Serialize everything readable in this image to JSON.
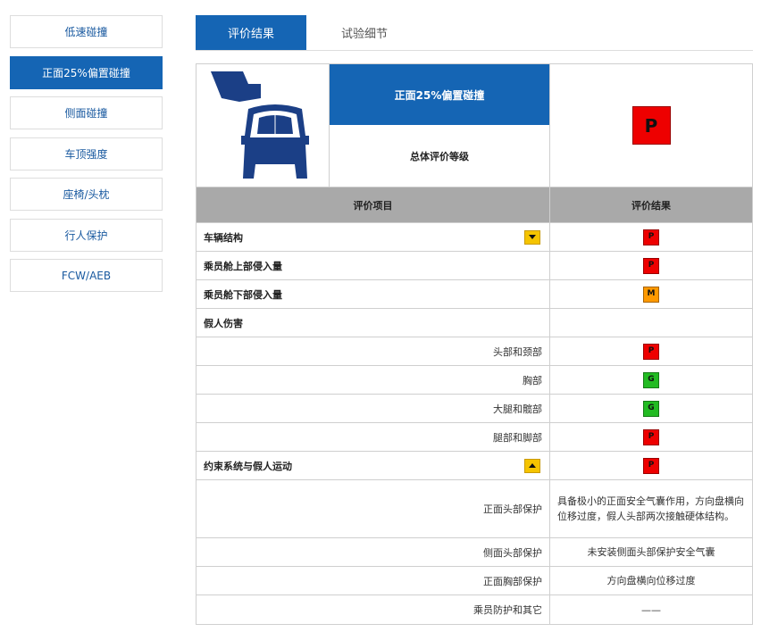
{
  "colors": {
    "primary": "#1565b4",
    "poor": "#ee0000",
    "marginal": "#ff9900",
    "good": "#22bb22",
    "toggle": "#f5c400",
    "header_gray": "#a9a9a9"
  },
  "sidebar": {
    "items": [
      {
        "label": "低速碰撞",
        "active": false
      },
      {
        "label": "正面25%偏置碰撞",
        "active": true
      },
      {
        "label": "侧面碰撞",
        "active": false
      },
      {
        "label": "车顶强度",
        "active": false
      },
      {
        "label": "座椅/头枕",
        "active": false
      },
      {
        "label": "行人保护",
        "active": false
      },
      {
        "label": "FCW/AEB",
        "active": false
      }
    ]
  },
  "tabs": {
    "active": "评价结果",
    "inactive": "试验细节"
  },
  "summary": {
    "icon": "small-overlap-car-icon",
    "test_name": "正面25%偏置碰撞",
    "overall_label": "总体评价等级",
    "overall_rating": "P"
  },
  "table": {
    "header_item": "评价项目",
    "header_result": "评价结果",
    "rows": [
      {
        "label": "车辆结构",
        "rating": "P",
        "style": "bold",
        "toggle": "down"
      },
      {
        "label": "乘员舱上部侵入量",
        "rating": "P",
        "style": "bold"
      },
      {
        "label": "乘员舱下部侵入量",
        "rating": "M",
        "style": "bold"
      },
      {
        "label": "假人伤害",
        "rating": "",
        "style": "bold"
      },
      {
        "label": "头部和颈部",
        "rating": "P",
        "style": "sub"
      },
      {
        "label": "胸部",
        "rating": "G",
        "style": "sub"
      },
      {
        "label": "大腿和髋部",
        "rating": "G",
        "style": "sub"
      },
      {
        "label": "腿部和脚部",
        "rating": "P",
        "style": "sub"
      },
      {
        "label": "约束系统与假人运动",
        "rating": "P",
        "style": "bold",
        "toggle": "up"
      },
      {
        "label": "正面头部保护",
        "text": "具备极小的正面安全气囊作用，方向盘横向位移过度，假人头部两次接触硬体结构。",
        "style": "sub",
        "tall": true
      },
      {
        "label": "侧面头部保护",
        "text": "未安装侧面头部保护安全气囊",
        "style": "sub"
      },
      {
        "label": "正面胸部保护",
        "text": "方向盘横向位移过度",
        "style": "sub"
      },
      {
        "label": "乘员防护和其它",
        "text": "——",
        "style": "sub"
      }
    ]
  }
}
